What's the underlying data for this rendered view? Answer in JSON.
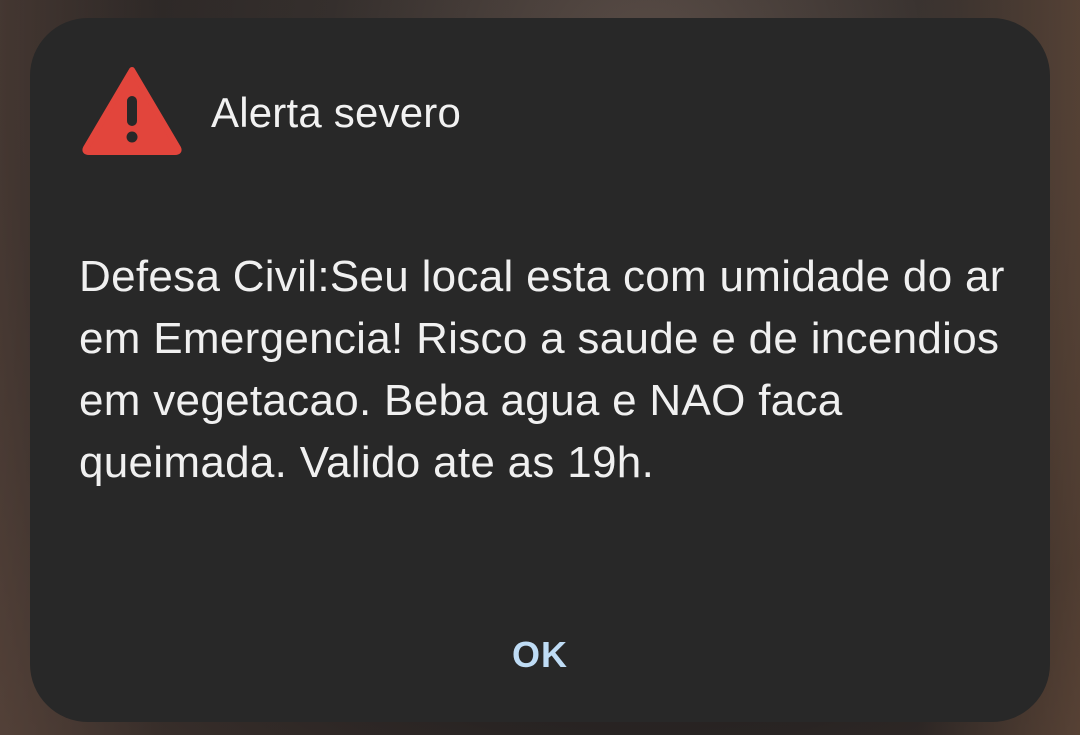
{
  "alert": {
    "icon": "warning-triangle-icon",
    "icon_color": "#e2453c",
    "title": "Alerta severo",
    "message": "Defesa Civil:Seu local esta com umidade do ar em Emergencia! Risco a saude e de incendios em vegetacao. Beba agua e NAO faca queimada. Valido ate as 19h.",
    "ok_label": "OK"
  },
  "colors": {
    "dialog_background": "#282828",
    "text": "#f0f0f0",
    "button_text": "#bfdcf5"
  }
}
